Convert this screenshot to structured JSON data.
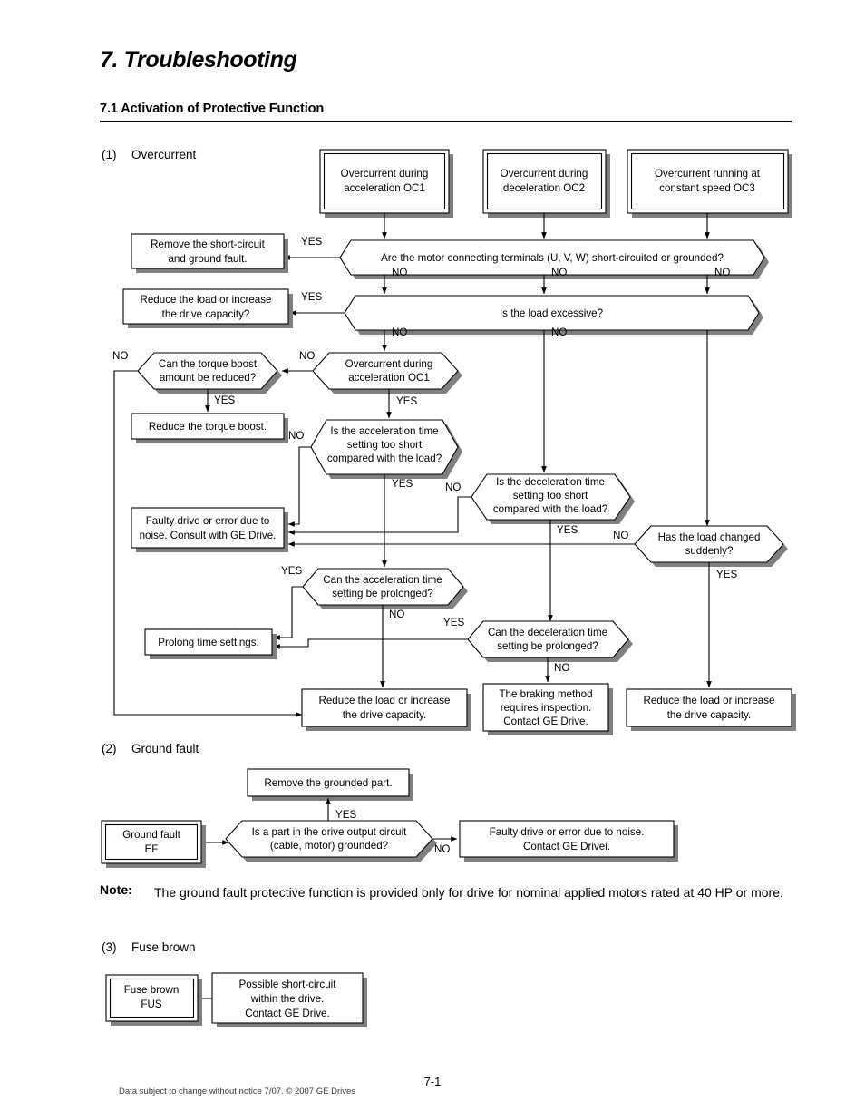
{
  "document": {
    "chapter_title": "7. Troubleshooting",
    "section_title": "7.1 Activation of Protective Function",
    "page_number": "7-1",
    "footer_note": "Data subject to change without notice 7/07. © 2007 GE Drives"
  },
  "parts": {
    "one": {
      "num": "(1)",
      "label": "Overcurrent"
    },
    "two": {
      "num": "(2)",
      "label": "Ground fault"
    },
    "three": {
      "num": "(3)",
      "label": "Fuse brown"
    }
  },
  "note": {
    "word": "Note:",
    "text": "The ground fault protective function is provided only for drive for nominal applied motors rated at 40 HP or more."
  },
  "overcurrent": {
    "terminals": {
      "oc1": {
        "l1": "Overcurrent during",
        "l2": "acceleration OC1"
      },
      "oc2": {
        "l1": "Overcurrent during",
        "l2": "deceleration OC2"
      },
      "oc3": {
        "l1": "Overcurrent running at",
        "l2": "constant speed OC3"
      }
    },
    "decisions": {
      "short_circuit": "Are the motor connecting terminals (U, V, W) short-circuited or grounded?",
      "load_excessive": "Is the load excessive?",
      "oc1_repeat": {
        "l1": "Overcurrent during",
        "l2": "acceleration OC1"
      },
      "torque_boost": {
        "l1": "Can the torque boost",
        "l2": "amount be reduced?"
      },
      "accel_short": {
        "l1": "Is the acceleration time",
        "l2": "setting too short",
        "l3": "compared with the load?"
      },
      "decel_short": {
        "l1": "Is the deceleration time",
        "l2": "setting too short",
        "l3": "compared with the load?"
      },
      "load_changed": {
        "l1": "Has the load changed",
        "l2": "suddenly?"
      },
      "accel_prolong": {
        "l1": "Can the acceleration time",
        "l2": "setting be prolonged?"
      },
      "decel_prolong": {
        "l1": "Can the deceleration time",
        "l2": "setting be prolonged?"
      }
    },
    "actions": {
      "remove_short": {
        "l1": "Remove the short-circuit",
        "l2": "and ground fault."
      },
      "reduce_load_q": {
        "l1": "Reduce the load or increase",
        "l2": "the drive capacity?"
      },
      "reduce_torque": {
        "l1": "Reduce the torque boost."
      },
      "faulty_drive": {
        "l1": "Faulty drive or error due to",
        "l2": "noise. Consult with GE Drive."
      },
      "prolong_time": {
        "l1": "Prolong time settings."
      },
      "reduce_load_mid": {
        "l1": "Reduce the load or increase",
        "l2": "the drive capacity."
      },
      "braking": {
        "l1": "The braking method",
        "l2": "requires inspection.",
        "l3": "Contact GE Drive."
      },
      "reduce_load_right": {
        "l1": "Reduce the load or increase",
        "l2": "the drive capacity."
      }
    },
    "branch_labels": {
      "yes": "YES",
      "no": "NO"
    }
  },
  "ground_fault": {
    "terminal": {
      "l1": "Ground fault",
      "l2": "EF"
    },
    "decision": {
      "l1": "Is a part in the drive output circuit",
      "l2": "(cable, motor) grounded?"
    },
    "remove": {
      "l1": "Remove the grounded part."
    },
    "faulty": {
      "l1": "Faulty drive or error due to noise.",
      "l2": "Contact GE Drivei."
    },
    "yes": "YES",
    "no": "NO"
  },
  "fuse_brown": {
    "terminal": {
      "l1": "Fuse brown",
      "l2": "FUS"
    },
    "result": {
      "l1": "Possible short-circuit",
      "l2": "within the drive.",
      "l3": "Contact GE Drive."
    }
  }
}
